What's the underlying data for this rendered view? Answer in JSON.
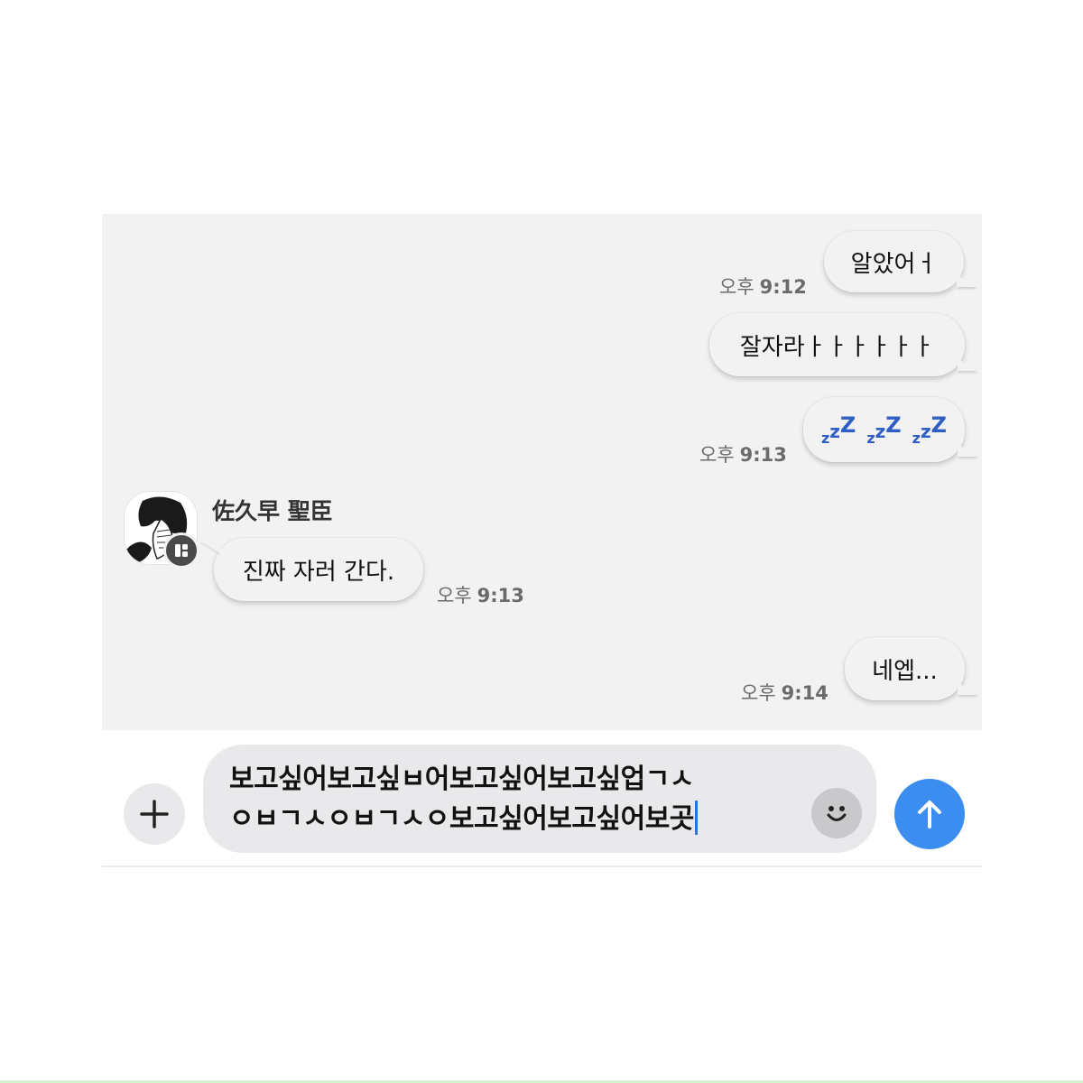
{
  "messages": [
    {
      "side": "mine",
      "text": "알았어ㅓ",
      "time_ampm": "오후",
      "time": "9:12"
    },
    {
      "side": "mine",
      "text": "잘자라ㅏㅏㅏㅏㅏㅏ"
    },
    {
      "side": "mine",
      "emoji": "sleeping-zzz",
      "time_ampm": "오후",
      "time": "9:13"
    },
    {
      "side": "theirs",
      "sender": "佐久早 聖臣",
      "text": "진짜 자러 간다.",
      "time_ampm": "오후",
      "time": "9:13"
    },
    {
      "side": "mine",
      "text": "네엡...",
      "time_ampm": "오후",
      "time": "9:14"
    }
  ],
  "composer": {
    "line1": "보고싶어보고싶ㅂ어보고싶어보고싶업ㄱㅅ",
    "line2": "ㅇㅂㄱㅅㅇㅂㄱㅅㅇ보고싶어보고싶어보곳"
  },
  "icons": {
    "plus": "plus-icon",
    "emoji": "smiley-icon",
    "send": "arrow-up-icon",
    "badge": "app-badge-icon"
  },
  "colors": {
    "send_button": "#3b8def",
    "chat_background": "#f2f2f2",
    "zzz": "#2f5ec4"
  }
}
